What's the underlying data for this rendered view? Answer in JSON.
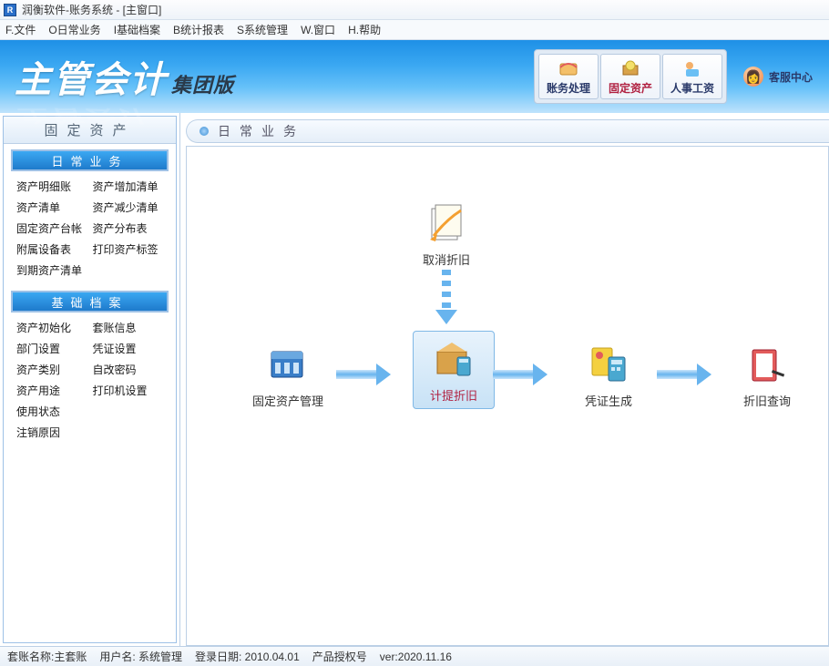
{
  "titlebar": {
    "text": "润衡软件-账务系统 - [主窗口]"
  },
  "menubar": [
    "F.文件",
    "O日常业务",
    "I基础档案",
    "B统计报表",
    "S系统管理",
    "W.窗口",
    "H.帮助"
  ],
  "logo": {
    "main": "主管会计",
    "sub": "集团版"
  },
  "top_buttons": [
    {
      "label": "账务处理",
      "active": false
    },
    {
      "label": "固定资产",
      "active": true
    },
    {
      "label": "人事工资",
      "active": false
    }
  ],
  "service_label": "客服中心",
  "sidebar": {
    "title": "固定资产",
    "sections": [
      {
        "header": "日常业务",
        "links": [
          "资产明细账",
          "资产增加清单",
          "资产清单",
          "资产减少清单",
          "固定资产台帐",
          "资产分布表",
          "附属设备表",
          "打印资产标签",
          "到期资产清单",
          ""
        ]
      },
      {
        "header": "基础档案",
        "links": [
          "资产初始化",
          "套账信息",
          "部门设置",
          "凭证设置",
          "资产类别",
          "自改密码",
          "资产用途",
          "打印机设置",
          "使用状态",
          "",
          "注销原因",
          ""
        ]
      }
    ]
  },
  "main": {
    "title": "日常业务",
    "flow": {
      "cancel_dep": "取消折旧",
      "asset_mgmt": "固定资产管理",
      "calc_dep": "计提折旧",
      "voucher_gen": "凭证生成",
      "dep_query": "折旧查询"
    }
  },
  "statusbar": {
    "account": "套账名称:主套账",
    "user": "用户名: 系统管理",
    "login_date": "登录日期: 2010.04.01",
    "license": "产品授权号",
    "version": "ver:2020.11.16"
  }
}
